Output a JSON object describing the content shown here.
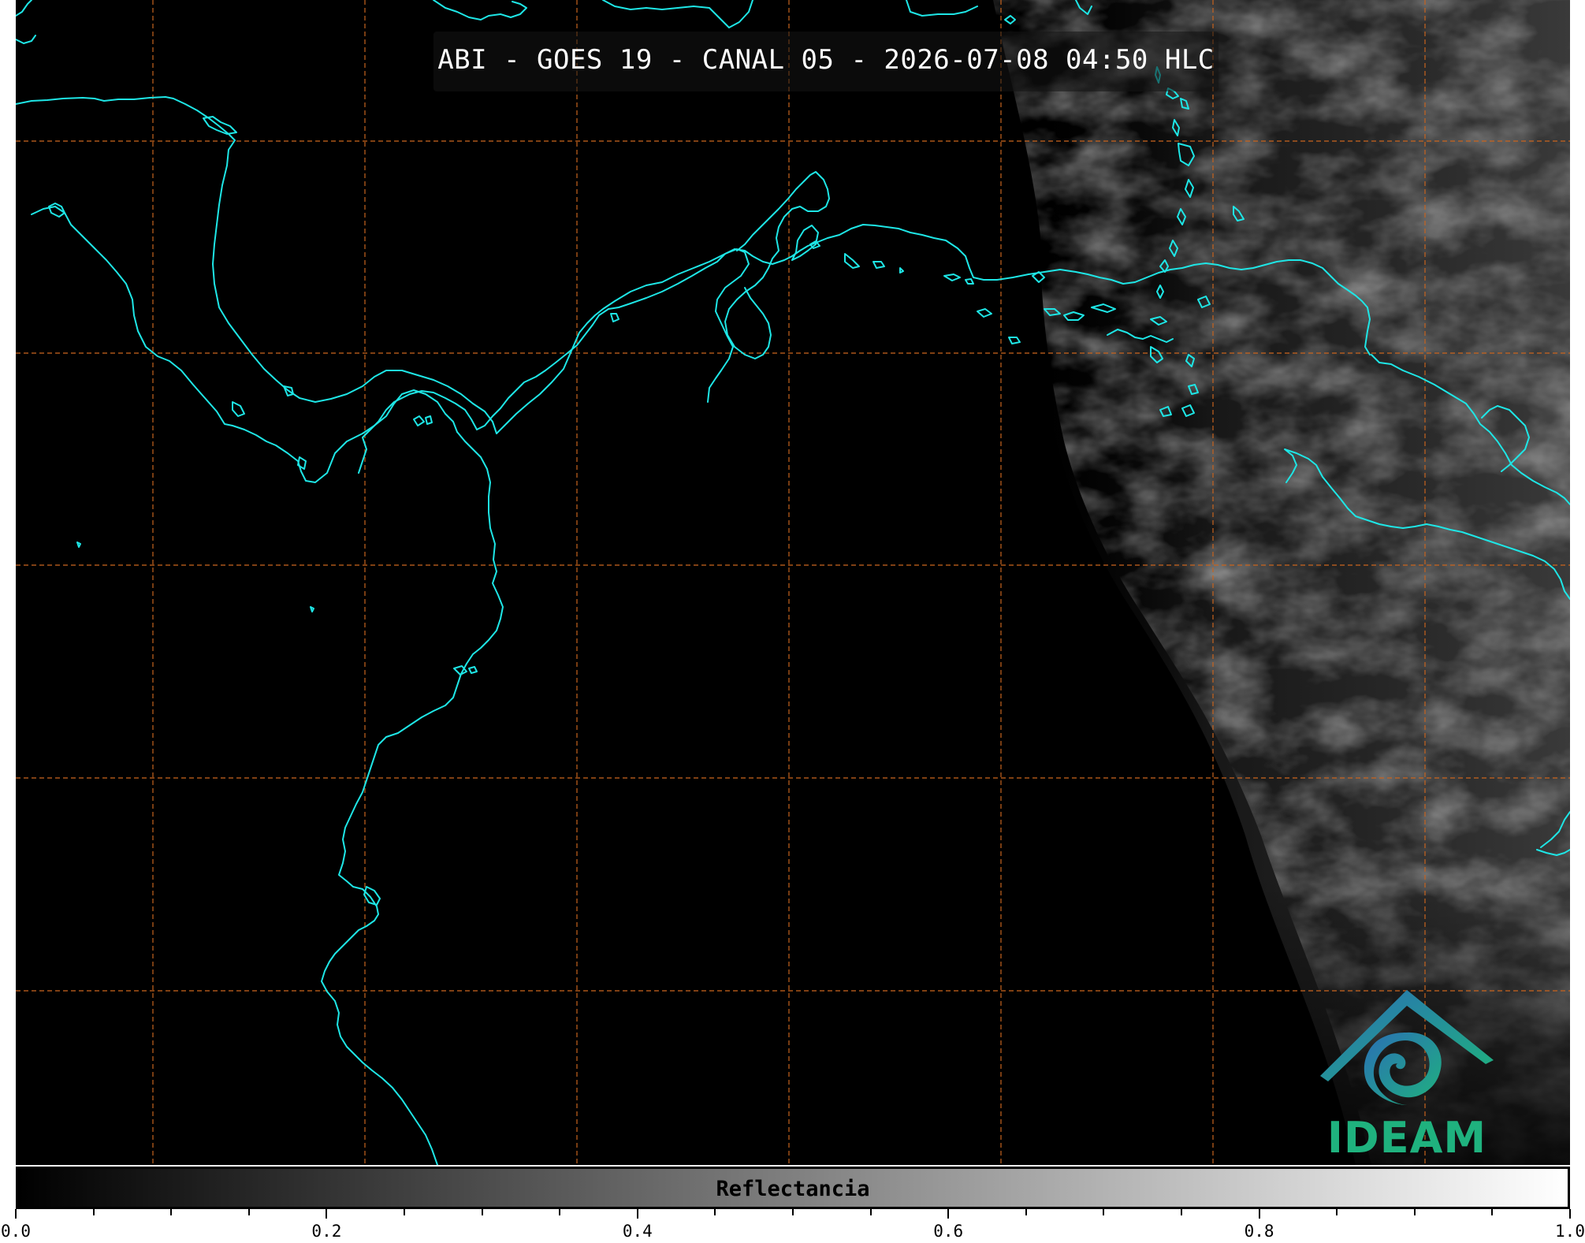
{
  "map": {
    "title": "ABI - GOES 19 - CANAL 05 - 2026-07-08 04:50 HLC",
    "colors": {
      "background": "#000000",
      "coastline": "#1ee6e6",
      "gridline": "#c8641e",
      "cloud_shade": "#3a3a3a"
    },
    "logo": {
      "text": "IDEAM",
      "colors": [
        "#2a6fb5",
        "#1fb27e"
      ]
    }
  },
  "colorbar": {
    "label": "Reflectancia",
    "gradient": [
      "#000000",
      "#ffffff"
    ],
    "range": [
      0.0,
      1.0
    ],
    "tick_labels": [
      "0.0",
      "0.2",
      "0.4",
      "0.6",
      "0.8",
      "1.0"
    ],
    "minor_step": 0.05
  }
}
